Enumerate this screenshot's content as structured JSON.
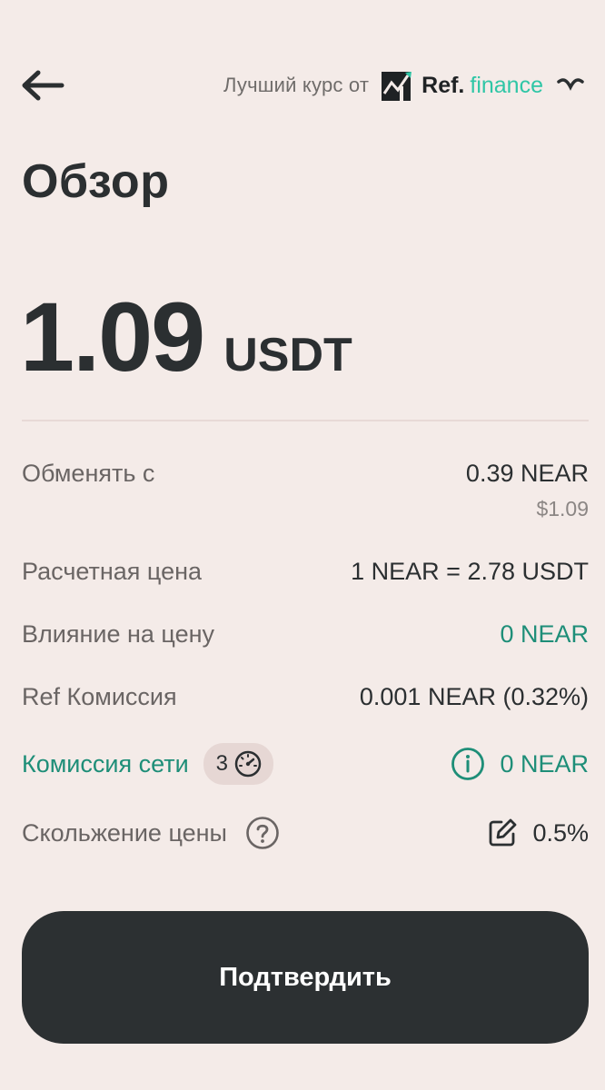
{
  "header": {
    "provider_label": "Лучший курс от",
    "provider_brand_main": "Ref.",
    "provider_brand_accent": "finance"
  },
  "title": "Обзор",
  "amount": {
    "value": "1.09",
    "unit": "USDT"
  },
  "details": {
    "swap_from": {
      "label": "Обменять с",
      "value": "0.39 NEAR",
      "sub": "$1.09"
    },
    "rate": {
      "label": "Расчетная цена",
      "value": "1 NEAR = 2.78 USDT"
    },
    "price_impact": {
      "label": "Влияние на цену",
      "value": "0 NEAR"
    },
    "ref_fee": {
      "label": "Ref Комиссия",
      "value": "0.001 NEAR (0.32%)"
    },
    "network_fee": {
      "label": "Комиссия сети",
      "speed": "3",
      "value": "0 NEAR"
    },
    "slippage": {
      "label": "Скольжение цены",
      "value": "0.5%"
    }
  },
  "confirm_label": "Подтвердить",
  "colors": {
    "background": "#f4ebe8",
    "accent_green": "#1e8e78",
    "brand_teal": "#2fc6a6",
    "button": "#2c3032"
  },
  "icons": {
    "back": "arrow-left-icon",
    "ref_logo": "ref-finance-logo",
    "chevron": "chevron-down-icon",
    "speed": "speedometer-icon",
    "help": "question-circle-icon",
    "info": "info-circle-icon",
    "edit": "edit-icon"
  }
}
